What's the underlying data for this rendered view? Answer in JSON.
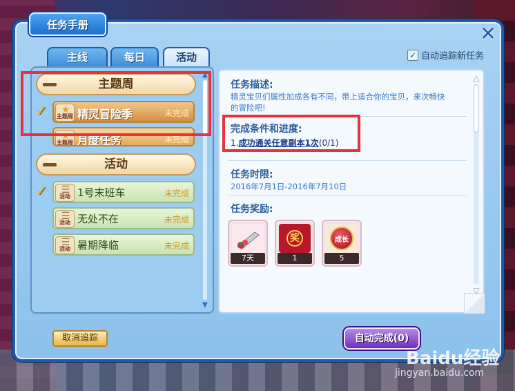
{
  "window": {
    "title": "任务手册",
    "close_icon": "close-icon",
    "auto_track_label": "自动追踪新任务",
    "auto_track_checked": true
  },
  "tabs": [
    {
      "label": "主线",
      "active": false
    },
    {
      "label": "每日",
      "active": false
    },
    {
      "label": "活动",
      "active": true
    }
  ],
  "quest_list": {
    "groups": [
      {
        "label": "主题周",
        "items": [
          {
            "name": "精灵冒险季",
            "badge": "主题周",
            "status": "未完成",
            "selected": true,
            "tracked": true
          },
          {
            "name": "月度任务",
            "badge": "主题周",
            "status": "未完成",
            "selected": false,
            "tracked": false
          }
        ]
      },
      {
        "label": "活动",
        "items": [
          {
            "name": "1号末班车",
            "badge": "活动",
            "status": "未完成",
            "tracked": true
          },
          {
            "name": "无处不在",
            "badge": "活动",
            "status": "未完成",
            "tracked": false
          },
          {
            "name": "暑期降临",
            "badge": "活动",
            "status": "未完成",
            "tracked": false
          }
        ]
      }
    ]
  },
  "detail": {
    "desc_title": "任务描述:",
    "desc_text_1": "精灵宝贝们属性加成各有不同，带上适合你的宝贝，来次畅快",
    "desc_text_2": "的冒险吧!",
    "cond_title": "完成条件和进度:",
    "cond_prefix": "1.",
    "cond_link": "成功通关任意副本1次",
    "cond_progress": "(0/1)",
    "limit_title": "任务时限:",
    "limit_text": "2016年7月1日-2016年7月10日",
    "reward_title": "任务奖励:",
    "rewards": [
      {
        "icon": "flower-bouquet-icon",
        "qty": "7天"
      },
      {
        "icon": "red-envelope-icon",
        "qty": "1",
        "icon_text": "奖"
      },
      {
        "icon": "growth-potion-icon",
        "qty": "5",
        "icon_text": "成长"
      }
    ]
  },
  "buttons": {
    "cancel_track": "取消追踪",
    "auto_complete": "自动完成(0)"
  },
  "watermark": {
    "logo": "Baidu经验",
    "url": "jingyan.baidu.com"
  }
}
